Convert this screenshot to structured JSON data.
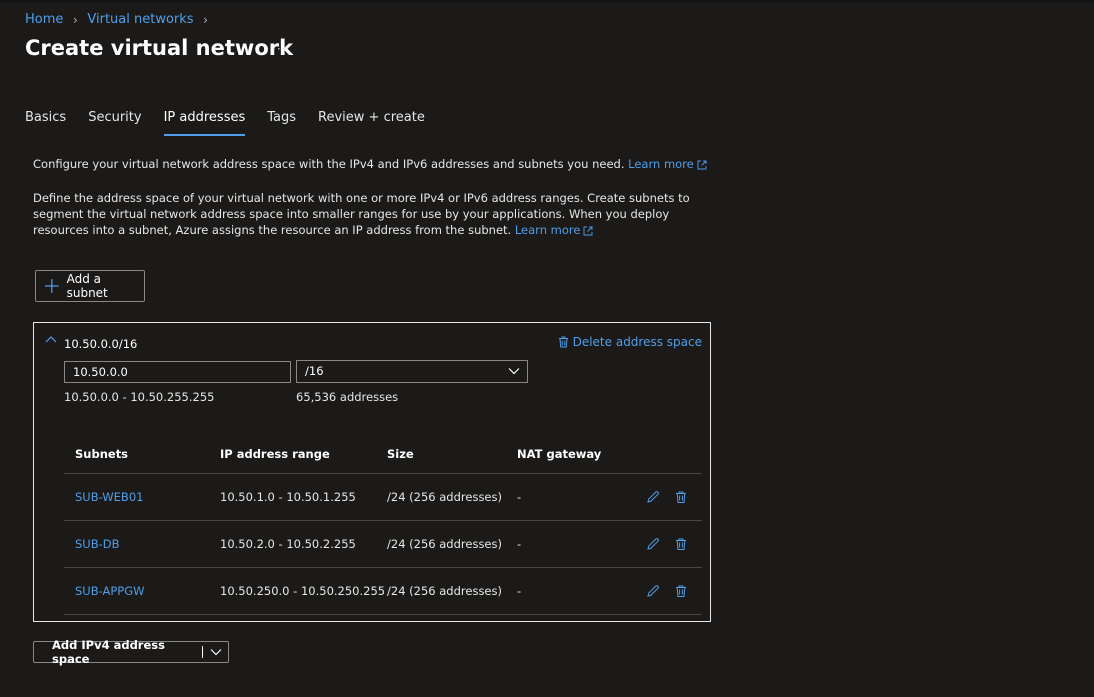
{
  "breadcrumb": {
    "home": "Home",
    "virtual_networks": "Virtual networks"
  },
  "page": {
    "title": "Create virtual network",
    "more": "···"
  },
  "tabs": [
    {
      "label": "Basics"
    },
    {
      "label": "Security"
    },
    {
      "label": "IP addresses",
      "active": true
    },
    {
      "label": "Tags"
    },
    {
      "label": "Review + create"
    }
  ],
  "intro": {
    "text": "Configure your virtual network address space with the IPv4 and IPv6 addresses and subnets you need.",
    "learn_more": "Learn more"
  },
  "description": {
    "text": "Define the address space of your virtual network with one or more IPv4 or IPv6 address ranges. Create subnets to segment the virtual network address space into smaller ranges for use by your applications. When you deploy resources into a subnet, Azure assigns the resource an IP address from the subnet.",
    "learn_more": "Learn more"
  },
  "add_subnet_label": "Add a subnet",
  "address_space": {
    "label": "10.50.0.0/16",
    "delete_label": "Delete address space",
    "address_value": "10.50.0.0",
    "prefix_value": "/16",
    "range": "10.50.0.0 - 10.50.255.255",
    "count": "65,536 addresses"
  },
  "subnets_table": {
    "headers": {
      "name": "Subnets",
      "range": "IP address range",
      "size": "Size",
      "nat": "NAT gateway"
    },
    "rows": [
      {
        "name": "SUB-WEB01",
        "range": "10.50.1.0 - 10.50.1.255",
        "size": "/24 (256 addresses)",
        "nat": "-"
      },
      {
        "name": "SUB-DB",
        "range": "10.50.2.0 - 10.50.2.255",
        "size": "/24 (256 addresses)",
        "nat": "-"
      },
      {
        "name": "SUB-APPGW",
        "range": "10.50.250.0 - 10.50.250.255",
        "size": "/24 (256 addresses)",
        "nat": "-"
      }
    ]
  },
  "add_ipv4_label": "Add IPv4 address space",
  "colors": {
    "accent": "#4f9ee8",
    "background": "#1b1a19",
    "border": "#8a8886"
  }
}
